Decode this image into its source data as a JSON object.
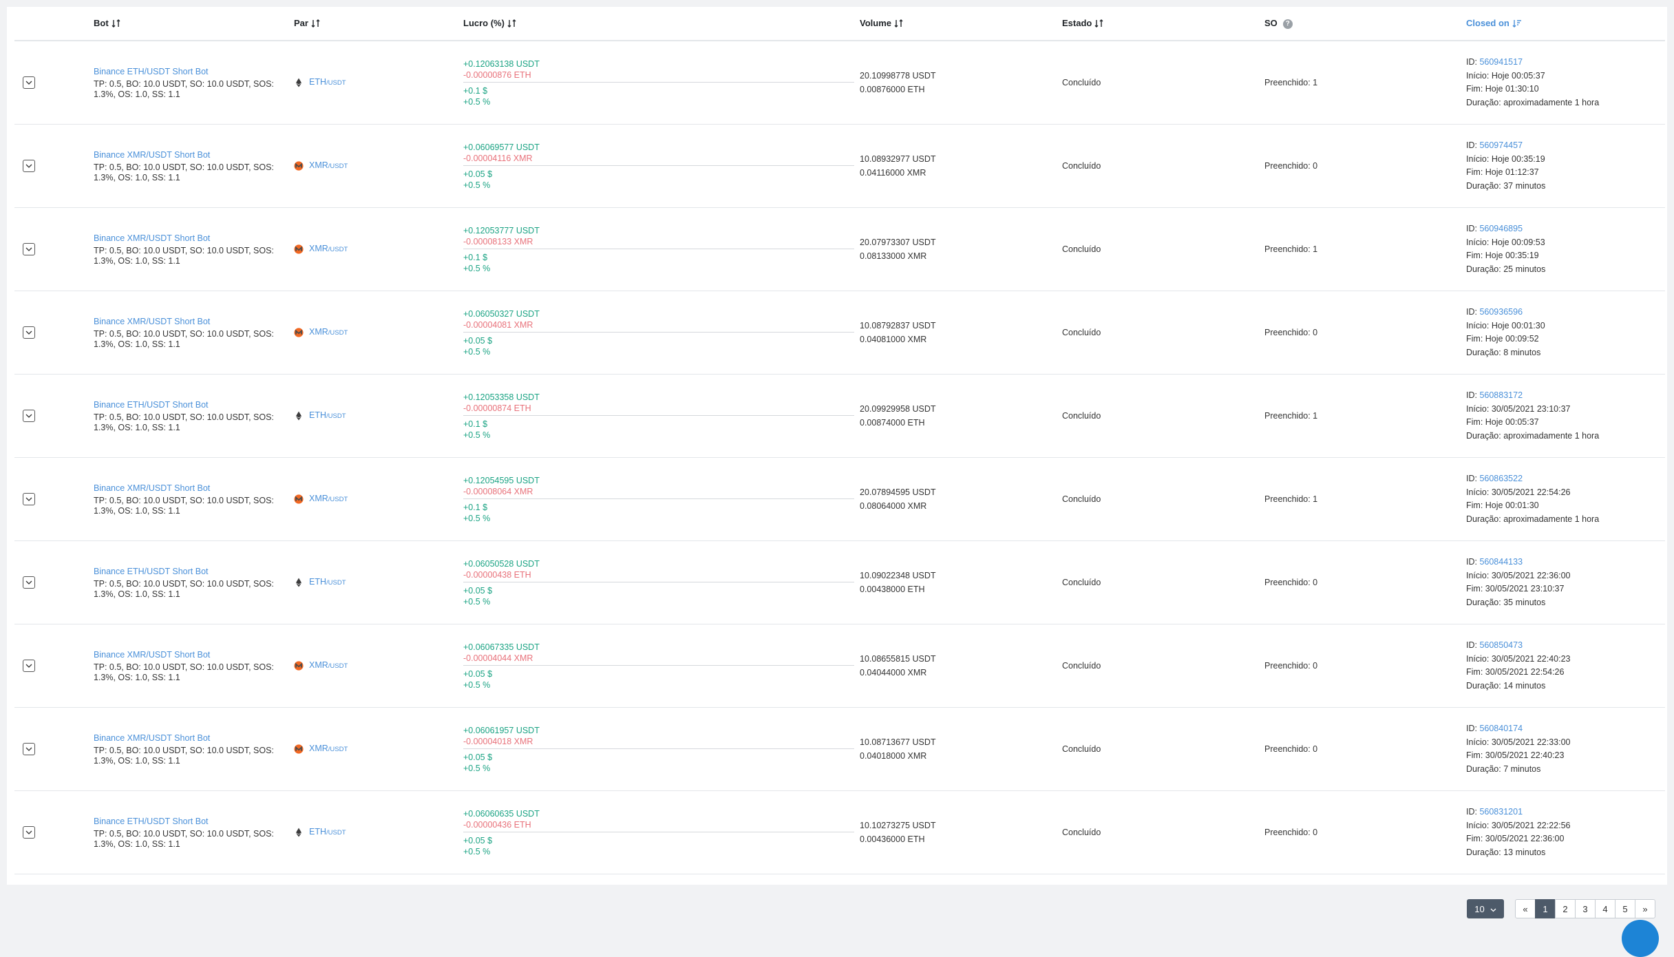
{
  "table": {
    "headers": {
      "bot": "Bot",
      "pair": "Par",
      "profit": "Lucro (%)",
      "volume": "Volume",
      "status": "Estado",
      "so": "SO",
      "closed_on": "Closed on"
    },
    "rows": [
      {
        "bot_name": "Binance ETH/USDT Short Bot",
        "bot_desc": "TP: 0.5, BO: 10.0 USDT, SO: 10.0 USDT, SOS: 1.3%, OS: 1.0, SS: 1.1",
        "coin": "eth",
        "pair_base": "ETH",
        "pair_quote": "/USDT",
        "profit_usdt": "+0.12063138 USDT",
        "profit_coin": "-0.00000876 ETH",
        "profit_usd": "+0.1 $",
        "profit_pct": "+0.5 %",
        "volume_usdt": "20.10998778 USDT",
        "volume_coin": "0.00876000 ETH",
        "status": "Concluído",
        "so": "Preenchido: 1",
        "id_label": "ID: ",
        "id": "560941517",
        "start": "Início: Hoje 00:05:37",
        "end": "Fim: Hoje 01:30:10",
        "duration": "Duração: aproximadamente 1 hora"
      },
      {
        "bot_name": "Binance XMR/USDT Short Bot",
        "bot_desc": "TP: 0.5, BO: 10.0 USDT, SO: 10.0 USDT, SOS: 1.3%, OS: 1.0, SS: 1.1",
        "coin": "xmr",
        "pair_base": "XMR",
        "pair_quote": "/USDT",
        "profit_usdt": "+0.06069577 USDT",
        "profit_coin": "-0.00004116 XMR",
        "profit_usd": "+0.05 $",
        "profit_pct": "+0.5 %",
        "volume_usdt": "10.08932977 USDT",
        "volume_coin": "0.04116000 XMR",
        "status": "Concluído",
        "so": "Preenchido: 0",
        "id_label": "ID: ",
        "id": "560974457",
        "start": "Início: Hoje 00:35:19",
        "end": "Fim: Hoje 01:12:37",
        "duration": "Duração: 37 minutos"
      },
      {
        "bot_name": "Binance XMR/USDT Short Bot",
        "bot_desc": "TP: 0.5, BO: 10.0 USDT, SO: 10.0 USDT, SOS: 1.3%, OS: 1.0, SS: 1.1",
        "coin": "xmr",
        "pair_base": "XMR",
        "pair_quote": "/USDT",
        "profit_usdt": "+0.12053777 USDT",
        "profit_coin": "-0.00008133 XMR",
        "profit_usd": "+0.1 $",
        "profit_pct": "+0.5 %",
        "volume_usdt": "20.07973307 USDT",
        "volume_coin": "0.08133000 XMR",
        "status": "Concluído",
        "so": "Preenchido: 1",
        "id_label": "ID: ",
        "id": "560946895",
        "start": "Início: Hoje 00:09:53",
        "end": "Fim: Hoje 00:35:19",
        "duration": "Duração: 25 minutos"
      },
      {
        "bot_name": "Binance XMR/USDT Short Bot",
        "bot_desc": "TP: 0.5, BO: 10.0 USDT, SO: 10.0 USDT, SOS: 1.3%, OS: 1.0, SS: 1.1",
        "coin": "xmr",
        "pair_base": "XMR",
        "pair_quote": "/USDT",
        "profit_usdt": "+0.06050327 USDT",
        "profit_coin": "-0.00004081 XMR",
        "profit_usd": "+0.05 $",
        "profit_pct": "+0.5 %",
        "volume_usdt": "10.08792837 USDT",
        "volume_coin": "0.04081000 XMR",
        "status": "Concluído",
        "so": "Preenchido: 0",
        "id_label": "ID: ",
        "id": "560936596",
        "start": "Início: Hoje 00:01:30",
        "end": "Fim: Hoje 00:09:52",
        "duration": "Duração: 8 minutos"
      },
      {
        "bot_name": "Binance ETH/USDT Short Bot",
        "bot_desc": "TP: 0.5, BO: 10.0 USDT, SO: 10.0 USDT, SOS: 1.3%, OS: 1.0, SS: 1.1",
        "coin": "eth",
        "pair_base": "ETH",
        "pair_quote": "/USDT",
        "profit_usdt": "+0.12053358 USDT",
        "profit_coin": "-0.00000874 ETH",
        "profit_usd": "+0.1 $",
        "profit_pct": "+0.5 %",
        "volume_usdt": "20.09929958 USDT",
        "volume_coin": "0.00874000 ETH",
        "status": "Concluído",
        "so": "Preenchido: 1",
        "id_label": "ID: ",
        "id": "560883172",
        "start": "Início: 30/05/2021 23:10:37",
        "end": "Fim: Hoje 00:05:37",
        "duration": "Duração: aproximadamente 1 hora"
      },
      {
        "bot_name": "Binance XMR/USDT Short Bot",
        "bot_desc": "TP: 0.5, BO: 10.0 USDT, SO: 10.0 USDT, SOS: 1.3%, OS: 1.0, SS: 1.1",
        "coin": "xmr",
        "pair_base": "XMR",
        "pair_quote": "/USDT",
        "profit_usdt": "+0.12054595 USDT",
        "profit_coin": "-0.00008064 XMR",
        "profit_usd": "+0.1 $",
        "profit_pct": "+0.5 %",
        "volume_usdt": "20.07894595 USDT",
        "volume_coin": "0.08064000 XMR",
        "status": "Concluído",
        "so": "Preenchido: 1",
        "id_label": "ID: ",
        "id": "560863522",
        "start": "Início: 30/05/2021 22:54:26",
        "end": "Fim: Hoje 00:01:30",
        "duration": "Duração: aproximadamente 1 hora"
      },
      {
        "bot_name": "Binance ETH/USDT Short Bot",
        "bot_desc": "TP: 0.5, BO: 10.0 USDT, SO: 10.0 USDT, SOS: 1.3%, OS: 1.0, SS: 1.1",
        "coin": "eth",
        "pair_base": "ETH",
        "pair_quote": "/USDT",
        "profit_usdt": "+0.06050528 USDT",
        "profit_coin": "-0.00000438 ETH",
        "profit_usd": "+0.05 $",
        "profit_pct": "+0.5 %",
        "volume_usdt": "10.09022348 USDT",
        "volume_coin": "0.00438000 ETH",
        "status": "Concluído",
        "so": "Preenchido: 0",
        "id_label": "ID: ",
        "id": "560844133",
        "start": "Início: 30/05/2021 22:36:00",
        "end": "Fim: 30/05/2021 23:10:37",
        "duration": "Duração: 35 minutos"
      },
      {
        "bot_name": "Binance XMR/USDT Short Bot",
        "bot_desc": "TP: 0.5, BO: 10.0 USDT, SO: 10.0 USDT, SOS: 1.3%, OS: 1.0, SS: 1.1",
        "coin": "xmr",
        "pair_base": "XMR",
        "pair_quote": "/USDT",
        "profit_usdt": "+0.06067335 USDT",
        "profit_coin": "-0.00004044 XMR",
        "profit_usd": "+0.05 $",
        "profit_pct": "+0.5 %",
        "volume_usdt": "10.08655815 USDT",
        "volume_coin": "0.04044000 XMR",
        "status": "Concluído",
        "so": "Preenchido: 0",
        "id_label": "ID: ",
        "id": "560850473",
        "start": "Início: 30/05/2021 22:40:23",
        "end": "Fim: 30/05/2021 22:54:26",
        "duration": "Duração: 14 minutos"
      },
      {
        "bot_name": "Binance XMR/USDT Short Bot",
        "bot_desc": "TP: 0.5, BO: 10.0 USDT, SO: 10.0 USDT, SOS: 1.3%, OS: 1.0, SS: 1.1",
        "coin": "xmr",
        "pair_base": "XMR",
        "pair_quote": "/USDT",
        "profit_usdt": "+0.06061957 USDT",
        "profit_coin": "-0.00004018 XMR",
        "profit_usd": "+0.05 $",
        "profit_pct": "+0.5 %",
        "volume_usdt": "10.08713677 USDT",
        "volume_coin": "0.04018000 XMR",
        "status": "Concluído",
        "so": "Preenchido: 0",
        "id_label": "ID: ",
        "id": "560840174",
        "start": "Início: 30/05/2021 22:33:00",
        "end": "Fim: 30/05/2021 22:40:23",
        "duration": "Duração: 7 minutos"
      },
      {
        "bot_name": "Binance ETH/USDT Short Bot",
        "bot_desc": "TP: 0.5, BO: 10.0 USDT, SO: 10.0 USDT, SOS: 1.3%, OS: 1.0, SS: 1.1",
        "coin": "eth",
        "pair_base": "ETH",
        "pair_quote": "/USDT",
        "profit_usdt": "+0.06060635 USDT",
        "profit_coin": "-0.00000436 ETH",
        "profit_usd": "+0.05 $",
        "profit_pct": "+0.5 %",
        "volume_usdt": "10.10273275 USDT",
        "volume_coin": "0.00436000 ETH",
        "status": "Concluído",
        "so": "Preenchido: 0",
        "id_label": "ID: ",
        "id": "560831201",
        "start": "Início: 30/05/2021 22:22:56",
        "end": "Fim: 30/05/2021 22:36:00",
        "duration": "Duração: 13 minutos"
      }
    ]
  },
  "pagination": {
    "per_page": "10",
    "first": "«",
    "last": "»",
    "pages": [
      "1",
      "2",
      "3",
      "4",
      "5"
    ],
    "current": "1"
  },
  "colors": {
    "link": "#4a90d9",
    "positive": "#1aa383",
    "negative": "#e8717a",
    "eth_icon": "#3c3c3d",
    "xmr_icon": "#f26822",
    "pager_active": "#4d5a69",
    "fab": "#1d84d6"
  },
  "icons": {
    "expand": "chevron-down-icon",
    "sort": "sort-icon",
    "sort_active": "sort-descending-icon",
    "help": "question-circle-icon",
    "eth": "ethereum-icon",
    "xmr": "monero-icon"
  }
}
